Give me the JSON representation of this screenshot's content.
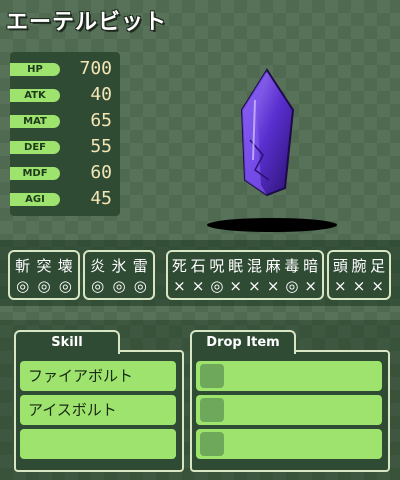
{
  "enemy": {
    "name": "エーテルビット"
  },
  "stats": [
    {
      "label": "HP",
      "value": "700"
    },
    {
      "label": "ATK",
      "value": "40"
    },
    {
      "label": "MAT",
      "value": "65"
    },
    {
      "label": "DEF",
      "value": "55"
    },
    {
      "label": "MDF",
      "value": "60"
    },
    {
      "label": "AGI",
      "value": "45"
    }
  ],
  "resist": {
    "physical": {
      "chars": [
        "斬",
        "突",
        "壊"
      ],
      "marks": [
        "◎",
        "◎",
        "◎"
      ]
    },
    "element": {
      "chars": [
        "炎",
        "氷",
        "雷"
      ],
      "marks": [
        "◎",
        "◎",
        "◎"
      ]
    },
    "status": {
      "chars": [
        "死",
        "石",
        "呪",
        "眠",
        "混",
        "麻",
        "毒",
        "暗"
      ],
      "marks": [
        "×",
        "×",
        "◎",
        "×",
        "×",
        "×",
        "◎",
        "×"
      ]
    },
    "parts": {
      "chars": [
        "頭",
        "腕",
        "足"
      ],
      "marks": [
        "×",
        "×",
        "×"
      ]
    }
  },
  "skill": {
    "tab_label": "Skill",
    "items": [
      "ファイアボルト",
      "アイスボルト",
      ""
    ]
  },
  "drop": {
    "tab_label": "Drop Item",
    "items": [
      "",
      "",
      ""
    ]
  },
  "colors": {
    "accent_green": "#9ee36d",
    "panel_dark": "#2f4b34",
    "crystal_purple": "#6a3de0"
  }
}
